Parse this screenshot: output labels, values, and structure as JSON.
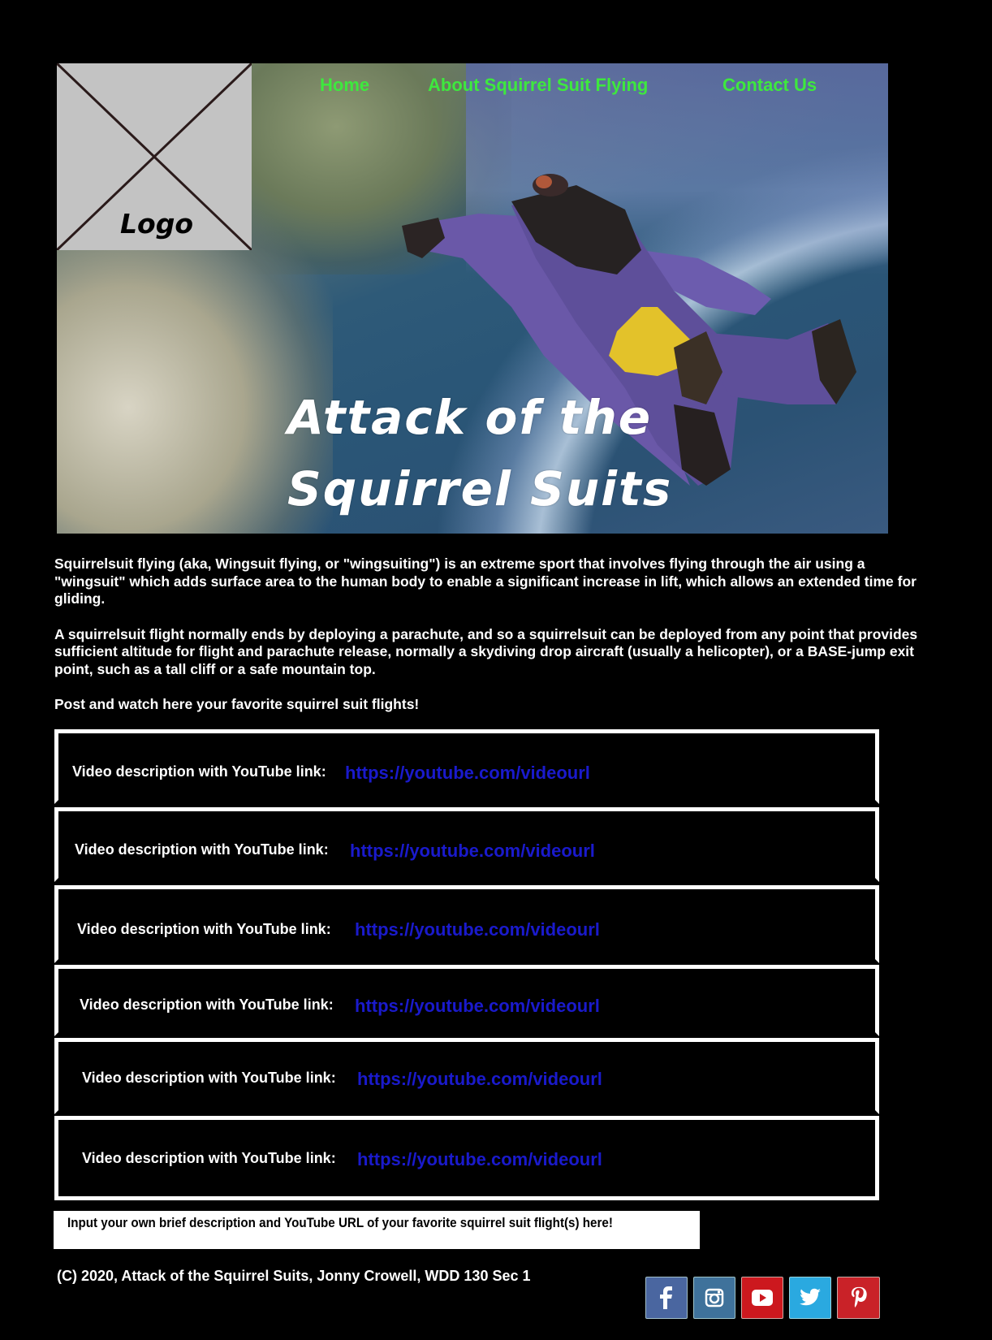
{
  "header": {
    "logo_text": "Logo",
    "nav": [
      {
        "label": "Home"
      },
      {
        "label": "About Squirrel Suit Flying"
      },
      {
        "label": "Contact Us"
      }
    ],
    "hero_title_line1": "Attack of the",
    "hero_title_line2": "Squirrel Suits",
    "nav_color": "#3ee83e"
  },
  "intro": {
    "paragraphs": [
      "Squirrelsuit flying (aka, Wingsuit flying, or \"wingsuiting\") is an extreme sport that involves flying through the air using a \"wingsuit\" which adds surface area to the human body to enable a significant increase in lift, which allows an extended time for gliding.",
      "A squirrelsuit flight normally ends by deploying a parachute, and so a squirrelsuit can be deployed from any point that provides sufficient altitude for flight and parachute release, normally a skydiving drop aircraft (usually a helicopter), or a BASE-jump exit point, such as a tall cliff or a safe mountain top.",
      "Post and watch here your favorite squirrel suit flights!"
    ]
  },
  "videos": [
    {
      "description": "Video description with YouTube link:",
      "url": "https://youtube.com/videourl"
    },
    {
      "description": "Video description with YouTube link:",
      "url": "https://youtube.com/videourl"
    },
    {
      "description": "Video description with YouTube link:",
      "url": "https://youtube.com/videourl"
    },
    {
      "description": "Video description with YouTube link:",
      "url": "https://youtube.com/videourl"
    },
    {
      "description": "Video description with YouTube link:",
      "url": "https://youtube.com/videourl"
    },
    {
      "description": "Video description with YouTube link:",
      "url": "https://youtube.com/videourl"
    }
  ],
  "link_color": "#1a1acc",
  "submission": {
    "placeholder": "Input your own brief description and YouTube URL of your favorite squirrel suit flight(s) here!"
  },
  "footer": {
    "copyright": "(C) 2020, Attack of the Squirrel Suits, Jonny Crowell, WDD 130 Sec 1",
    "social": [
      {
        "name": "Facebook",
        "icon": "facebook-icon",
        "color": "#4a66a0"
      },
      {
        "name": "Instagram",
        "icon": "instagram-icon",
        "color": "#3f729b"
      },
      {
        "name": "YouTube",
        "icon": "youtube-icon",
        "color": "#cc181e"
      },
      {
        "name": "Twitter",
        "icon": "twitter-icon",
        "color": "#2aa9e0"
      },
      {
        "name": "Pinterest",
        "icon": "pinterest-icon",
        "color": "#c92228"
      }
    ]
  }
}
